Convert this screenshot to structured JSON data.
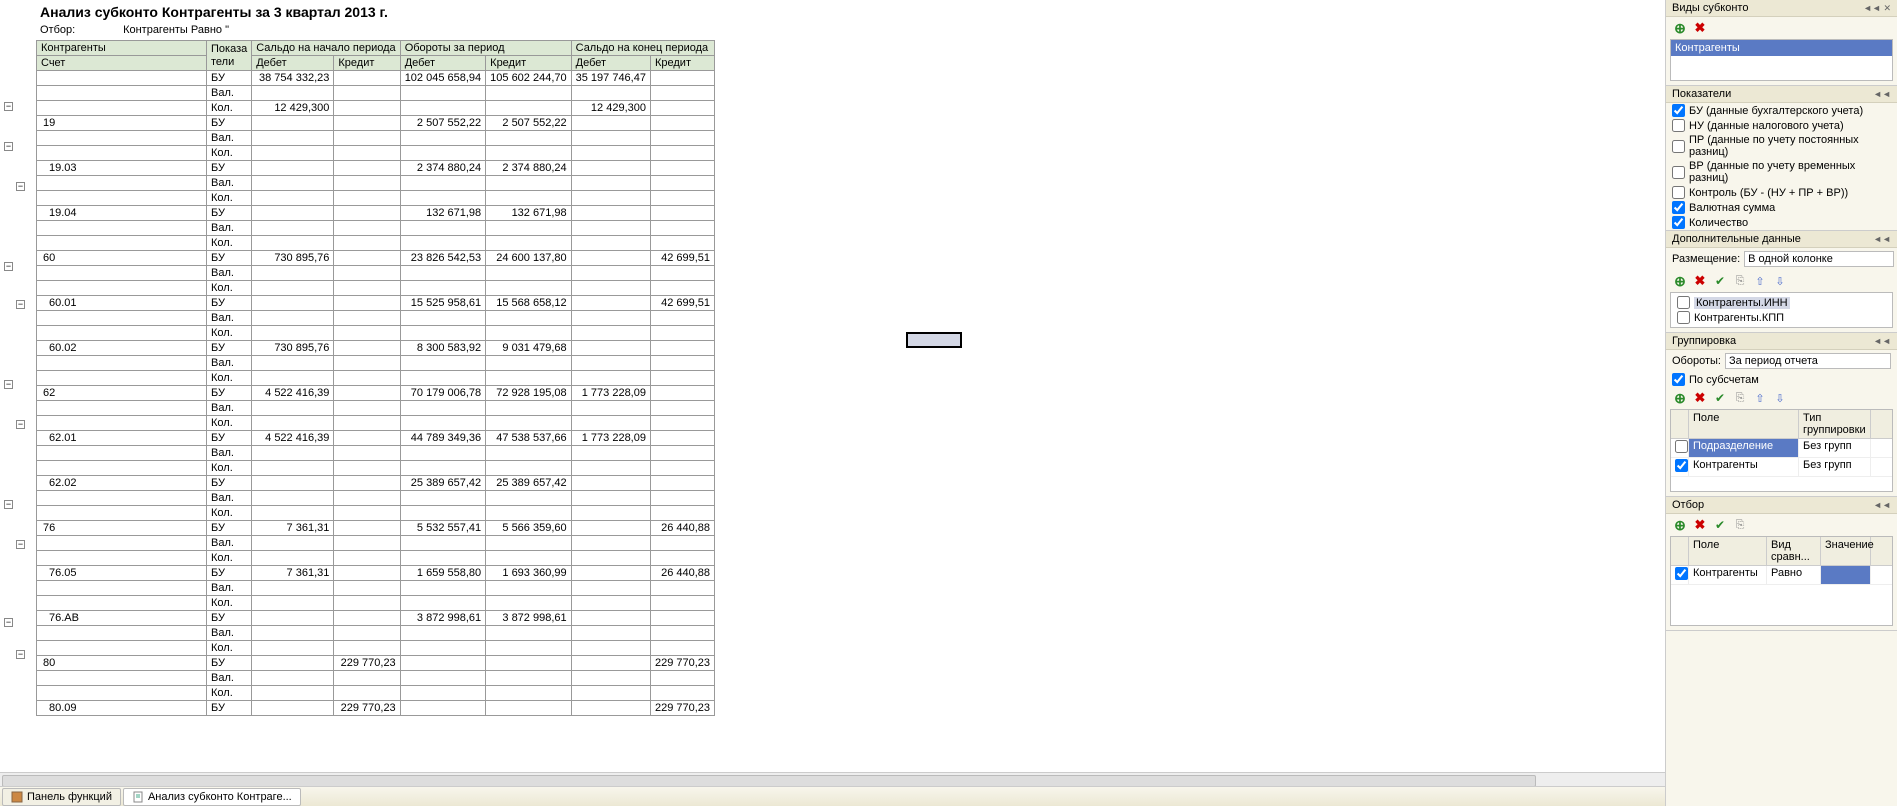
{
  "title": "Анализ субконто Контрагенты за 3 квартал 2013 г.",
  "filter": {
    "label": "Отбор:",
    "value": "Контрагенты Равно \""
  },
  "headers": {
    "kontragenty": "Контрагенты",
    "schet": "Счет",
    "pokazateli": "Показа\nтели",
    "saldo_start": "Сальдо на начало периода",
    "oboroty": "Обороты за период",
    "saldo_end": "Сальдо на конец периода",
    "debet": "Дебет",
    "kredit": "Кредит"
  },
  "indicators": {
    "bu": "БУ",
    "val": "Вал.",
    "kol": "Кол."
  },
  "rows": [
    {
      "acct": "",
      "vals": {
        "bu": [
          "38 754 332,23",
          "",
          "102 045 658,94",
          "105 602 244,70",
          "35 197 746,47",
          ""
        ],
        "kol": [
          "12 429,300",
          "",
          "",
          "",
          "12 429,300",
          ""
        ]
      }
    },
    {
      "acct": "19",
      "vals": {
        "bu": [
          "",
          "",
          "2 507 552,22",
          "2 507 552,22",
          "",
          ""
        ]
      }
    },
    {
      "acct": "19.03",
      "vals": {
        "bu": [
          "",
          "",
          "2 374 880,24",
          "2 374 880,24",
          "",
          ""
        ]
      }
    },
    {
      "acct": "19.04",
      "vals": {
        "bu": [
          "",
          "",
          "132 671,98",
          "132 671,98",
          "",
          ""
        ]
      }
    },
    {
      "acct": "60",
      "vals": {
        "bu": [
          "730 895,76",
          "",
          "23 826 542,53",
          "24 600 137,80",
          "",
          "42 699,51"
        ]
      }
    },
    {
      "acct": "60.01",
      "vals": {
        "bu": [
          "",
          "",
          "15 525 958,61",
          "15 568 658,12",
          "",
          "42 699,51"
        ]
      }
    },
    {
      "acct": "60.02",
      "vals": {
        "bu": [
          "730 895,76",
          "",
          "8 300 583,92",
          "9 031 479,68",
          "",
          ""
        ]
      }
    },
    {
      "acct": "62",
      "vals": {
        "bu": [
          "4 522 416,39",
          "",
          "70 179 006,78",
          "72 928 195,08",
          "1 773 228,09",
          ""
        ]
      }
    },
    {
      "acct": "62.01",
      "vals": {
        "bu": [
          "4 522 416,39",
          "",
          "44 789 349,36",
          "47 538 537,66",
          "1 773 228,09",
          ""
        ]
      }
    },
    {
      "acct": "62.02",
      "vals": {
        "bu": [
          "",
          "",
          "25 389 657,42",
          "25 389 657,42",
          "",
          ""
        ]
      }
    },
    {
      "acct": "76",
      "vals": {
        "bu": [
          "7 361,31",
          "",
          "5 532 557,41",
          "5 566 359,60",
          "",
          "26 440,88"
        ]
      }
    },
    {
      "acct": "76.05",
      "vals": {
        "bu": [
          "7 361,31",
          "",
          "1 659 558,80",
          "1 693 360,99",
          "",
          "26 440,88"
        ]
      }
    },
    {
      "acct": "76.АВ",
      "vals": {
        "bu": [
          "",
          "",
          "3 872 998,61",
          "3 872 998,61",
          "",
          ""
        ]
      }
    },
    {
      "acct": "80",
      "vals": {
        "bu": [
          "",
          "229 770,23",
          "",
          "",
          "",
          "229 770,23"
        ]
      }
    },
    {
      "acct": "80.09",
      "vals": {
        "bu": [
          "",
          "229 770,23",
          "",
          "",
          "",
          "229 770,23"
        ]
      },
      "single": true
    }
  ],
  "side": {
    "vidy": {
      "title": "Виды субконто",
      "item": "Контрагенты"
    },
    "pokaz": {
      "title": "Показатели",
      "items": [
        {
          "label": "БУ (данные бухгалтерского учета)",
          "checked": true
        },
        {
          "label": "НУ (данные налогового учета)",
          "checked": false
        },
        {
          "label": "ПР (данные по учету постоянных разниц)",
          "checked": false
        },
        {
          "label": "ВР (данные по учету временных разниц)",
          "checked": false
        },
        {
          "label": "Контроль (БУ - (НУ + ПР + ВР))",
          "checked": false
        },
        {
          "label": "Валютная сумма",
          "checked": true
        },
        {
          "label": "Количество",
          "checked": true
        }
      ]
    },
    "dop": {
      "title": "Дополнительные данные",
      "razm_label": "Размещение:",
      "razm_value": "В одной колонке",
      "items": [
        {
          "label": "Контрагенты.ИНН",
          "checked": false,
          "gray": true
        },
        {
          "label": "Контрагенты.КПП",
          "checked": false
        }
      ]
    },
    "grp": {
      "title": "Группировка",
      "ob_label": "Обороты:",
      "ob_value": "За период отчета",
      "sub_label": "По субсчетам",
      "hdr": {
        "pole": "Поле",
        "tip": "Тип группировки"
      },
      "rows": [
        {
          "checked": false,
          "pole": "Подразделение",
          "tip": "Без групп",
          "sel": true
        },
        {
          "checked": true,
          "pole": "Контрагенты",
          "tip": "Без групп"
        }
      ]
    },
    "otbor": {
      "title": "Отбор",
      "hdr": {
        "pole": "Поле",
        "vid": "Вид сравн...",
        "val": "Значение"
      },
      "rows": [
        {
          "checked": true,
          "pole": "Контрагенты",
          "vid": "Равно",
          "val": ""
        }
      ]
    }
  },
  "tabs": {
    "panel": "Панель функций",
    "report": "Анализ субконто Контраге..."
  }
}
